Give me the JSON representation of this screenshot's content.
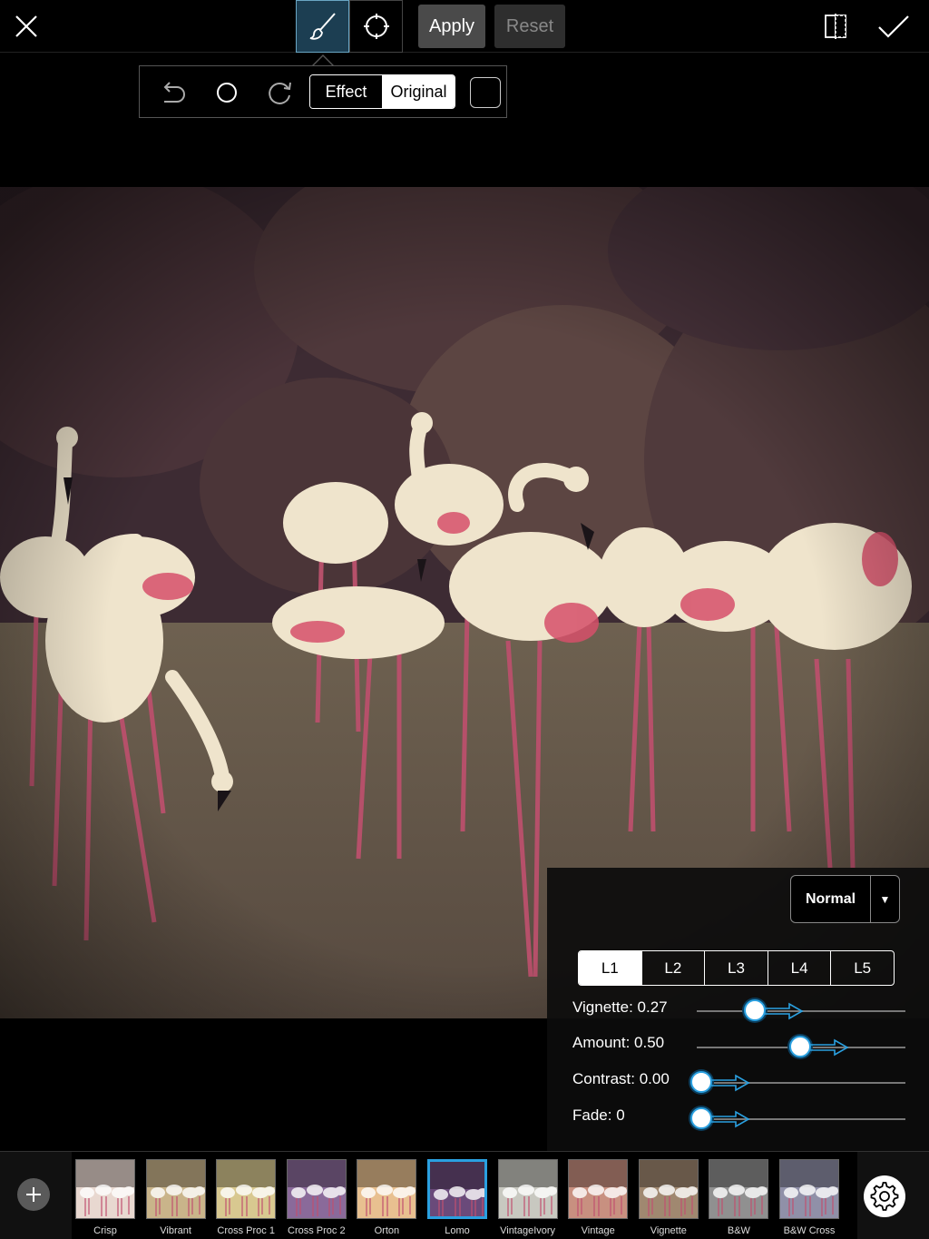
{
  "toolbar": {
    "apply_label": "Apply",
    "reset_label": "Reset",
    "icons": [
      "close-icon",
      "brush-icon",
      "target-icon",
      "compare-icon",
      "checkmark-icon"
    ]
  },
  "subbar": {
    "effect_label": "Effect",
    "original_label": "Original",
    "icons": [
      "undo-icon",
      "circle-icon",
      "redo-icon",
      "square-icon"
    ]
  },
  "panel": {
    "blend_mode": "Normal",
    "levels": [
      "L1",
      "L2",
      "L3",
      "L4",
      "L5"
    ],
    "active_level": "L1",
    "sliders": [
      {
        "label": "Vignette: 0.27",
        "value": 0.27
      },
      {
        "label": "Amount: 0.50",
        "value": 0.5
      },
      {
        "label": "Contrast: 0.00",
        "value": 0.0
      },
      {
        "label": "Fade: 0",
        "value": 0
      }
    ]
  },
  "filmstrip": {
    "presets": [
      "Crisp",
      "Vibrant",
      "Cross Proc 1",
      "Cross Proc 2",
      "Orton",
      "Lomo",
      "VintageIvory",
      "Vintage",
      "Vignette",
      "B&W",
      "B&W Cross"
    ],
    "selected": "Lomo"
  },
  "colors": {
    "accent": "#2aa0e0",
    "brush_active_bg": "#1c3e52"
  }
}
